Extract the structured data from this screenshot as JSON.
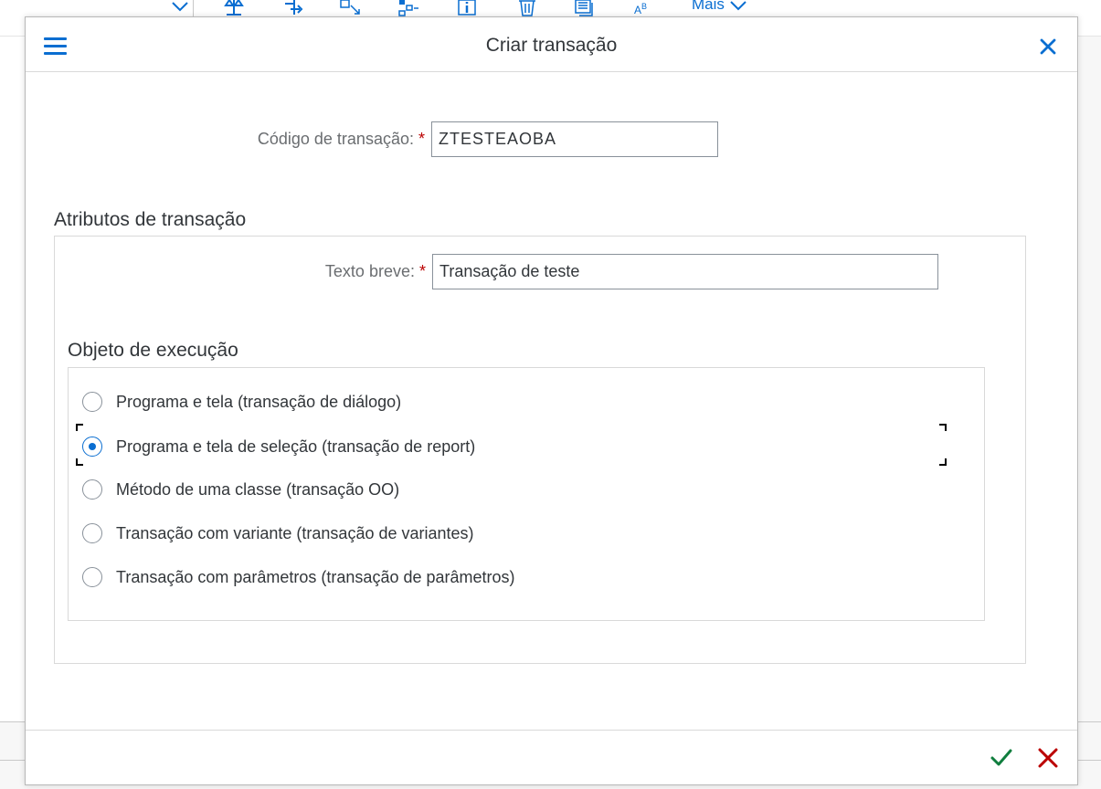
{
  "background": {
    "toolbar": {
      "icons": [
        "chevron-down-icon",
        "balance-icon",
        "hierarchy-icon",
        "expand-icon",
        "tree-icon",
        "info-icon",
        "trash-icon",
        "document-icon",
        "spell-check-icon"
      ],
      "more_label": "Mais"
    }
  },
  "dialog": {
    "title": "Criar transação",
    "transaction_code": {
      "label": "Código de transação:",
      "required_marker": "*",
      "value": "ZTESTEAOBA"
    },
    "attributes": {
      "title": "Atributos de transação",
      "short_text": {
        "label": "Texto breve:",
        "required_marker": "*",
        "value": "Transação de teste"
      },
      "execution_object": {
        "title": "Objeto de execução",
        "options": [
          {
            "label": "Programa e tela (transação de diálogo)",
            "selected": false
          },
          {
            "label": "Programa e tela de seleção (transação de report)",
            "selected": true
          },
          {
            "label": "Método de uma classe (transação OO)",
            "selected": false
          },
          {
            "label": "Transação com variante (transação de variantes)",
            "selected": false
          },
          {
            "label": "Transação com parâmetros (transação de parâmetros)",
            "selected": false
          }
        ]
      }
    },
    "footer": {
      "ok_icon": "checkmark-icon",
      "cancel_icon": "close-icon"
    }
  },
  "colors": {
    "accent": "#0a6ed1",
    "ok": "#107e3e",
    "cancel": "#bb0000",
    "required": "#bb0000"
  }
}
